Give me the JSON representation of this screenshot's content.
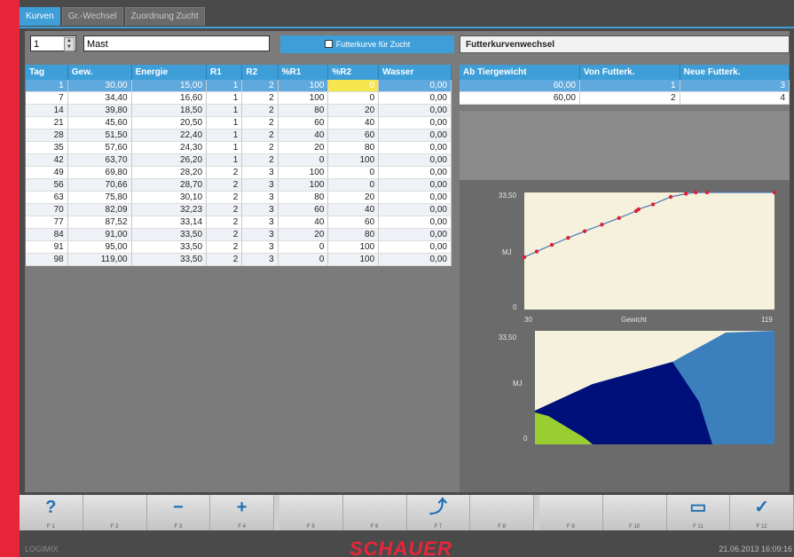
{
  "tabs": [
    {
      "label": "Kurven",
      "active": true
    },
    {
      "label": "Gr.-Wechsel",
      "active": false
    },
    {
      "label": "Zuordnung Zucht",
      "active": false
    }
  ],
  "curve": {
    "number": "1",
    "name": "Mast",
    "zucht_checkbox_label": "Futterkurve für Zucht"
  },
  "curve_table": {
    "headers": [
      "Tag",
      "Gew.",
      "Energie",
      "R1",
      "R2",
      "%R1",
      "%R2",
      "Wasser"
    ],
    "rows": [
      [
        "1",
        "30,00",
        "15,00",
        "1",
        "2",
        "100",
        "0",
        "0,00"
      ],
      [
        "7",
        "34,40",
        "16,60",
        "1",
        "2",
        "100",
        "0",
        "0,00"
      ],
      [
        "14",
        "39,80",
        "18,50",
        "1",
        "2",
        "80",
        "20",
        "0,00"
      ],
      [
        "21",
        "45,60",
        "20,50",
        "1",
        "2",
        "60",
        "40",
        "0,00"
      ],
      [
        "28",
        "51,50",
        "22,40",
        "1",
        "2",
        "40",
        "60",
        "0,00"
      ],
      [
        "35",
        "57,60",
        "24,30",
        "1",
        "2",
        "20",
        "80",
        "0,00"
      ],
      [
        "42",
        "63,70",
        "26,20",
        "1",
        "2",
        "0",
        "100",
        "0,00"
      ],
      [
        "49",
        "69,80",
        "28,20",
        "2",
        "3",
        "100",
        "0",
        "0,00"
      ],
      [
        "56",
        "70,66",
        "28,70",
        "2",
        "3",
        "100",
        "0",
        "0,00"
      ],
      [
        "63",
        "75,80",
        "30,10",
        "2",
        "3",
        "80",
        "20",
        "0,00"
      ],
      [
        "70",
        "82,09",
        "32,23",
        "2",
        "3",
        "60",
        "40",
        "0,00"
      ],
      [
        "77",
        "87,52",
        "33,14",
        "2",
        "3",
        "40",
        "60",
        "0,00"
      ],
      [
        "84",
        "91,00",
        "33,50",
        "2",
        "3",
        "20",
        "80",
        "0,00"
      ],
      [
        "91",
        "95,00",
        "33,50",
        "2",
        "3",
        "0",
        "100",
        "0,00"
      ],
      [
        "98",
        "119,00",
        "33,50",
        "2",
        "3",
        "0",
        "100",
        "0,00"
      ]
    ]
  },
  "change_table": {
    "title": "Futterkurvenwechsel",
    "headers": [
      "Ab Tiergewicht",
      "Von Futterk.",
      "Neue Futterk."
    ],
    "rows": [
      [
        "60,00",
        "1",
        "3"
      ],
      [
        "60,00",
        "2",
        "4"
      ]
    ]
  },
  "chart_line": {
    "y_max_label": "33,50",
    "y_unit": "MJ",
    "y_min_label": "0",
    "x_min_label": "30",
    "x_label": "Gewicht",
    "x_max_label": "119"
  },
  "chart_area": {
    "y_max_label": "33,50",
    "y_unit": "MJ",
    "y_min_label": "0"
  },
  "chart_data": [
    {
      "type": "line",
      "x": [
        30,
        34.4,
        39.8,
        45.6,
        51.5,
        57.6,
        63.7,
        69.8,
        70.66,
        75.8,
        82.09,
        87.52,
        91,
        95,
        119
      ],
      "y": [
        15,
        16.6,
        18.5,
        20.5,
        22.4,
        24.3,
        26.2,
        28.2,
        28.7,
        30.1,
        32.23,
        33.14,
        33.5,
        33.5,
        33.5
      ],
      "xlim": [
        30,
        119
      ],
      "ylim": [
        0,
        33.5
      ],
      "xlabel": "Gewicht",
      "ylabel": "MJ"
    },
    {
      "type": "area",
      "ylim": [
        0,
        33.5
      ],
      "ylabel": "MJ",
      "colors": [
        "#9acd32",
        "#00107a",
        "#3c7fbd"
      ]
    }
  ],
  "fkeys": [
    {
      "key": "F 1",
      "icon": "?"
    },
    {
      "key": "F 2",
      "icon": ""
    },
    {
      "key": "F 3",
      "icon": "−"
    },
    {
      "key": "F 4",
      "icon": "+"
    },
    {
      "key": "F 5",
      "icon": ""
    },
    {
      "key": "F 6",
      "icon": ""
    },
    {
      "key": "F 7",
      "icon": "⤴"
    },
    {
      "key": "F 8",
      "icon": ""
    },
    {
      "key": "F 9",
      "icon": ""
    },
    {
      "key": "F 10",
      "icon": ""
    },
    {
      "key": "F 11",
      "icon": "▭"
    },
    {
      "key": "F 12",
      "icon": "✓"
    }
  ],
  "footer": {
    "brand": "LOGIMIX",
    "logo": "SCHAUER",
    "datetime": "21.06.2013 16:09:16"
  },
  "colors": {
    "accent": "#3e9fd8",
    "brand_red": "#e8263a",
    "highlight": "#f5e64d"
  }
}
